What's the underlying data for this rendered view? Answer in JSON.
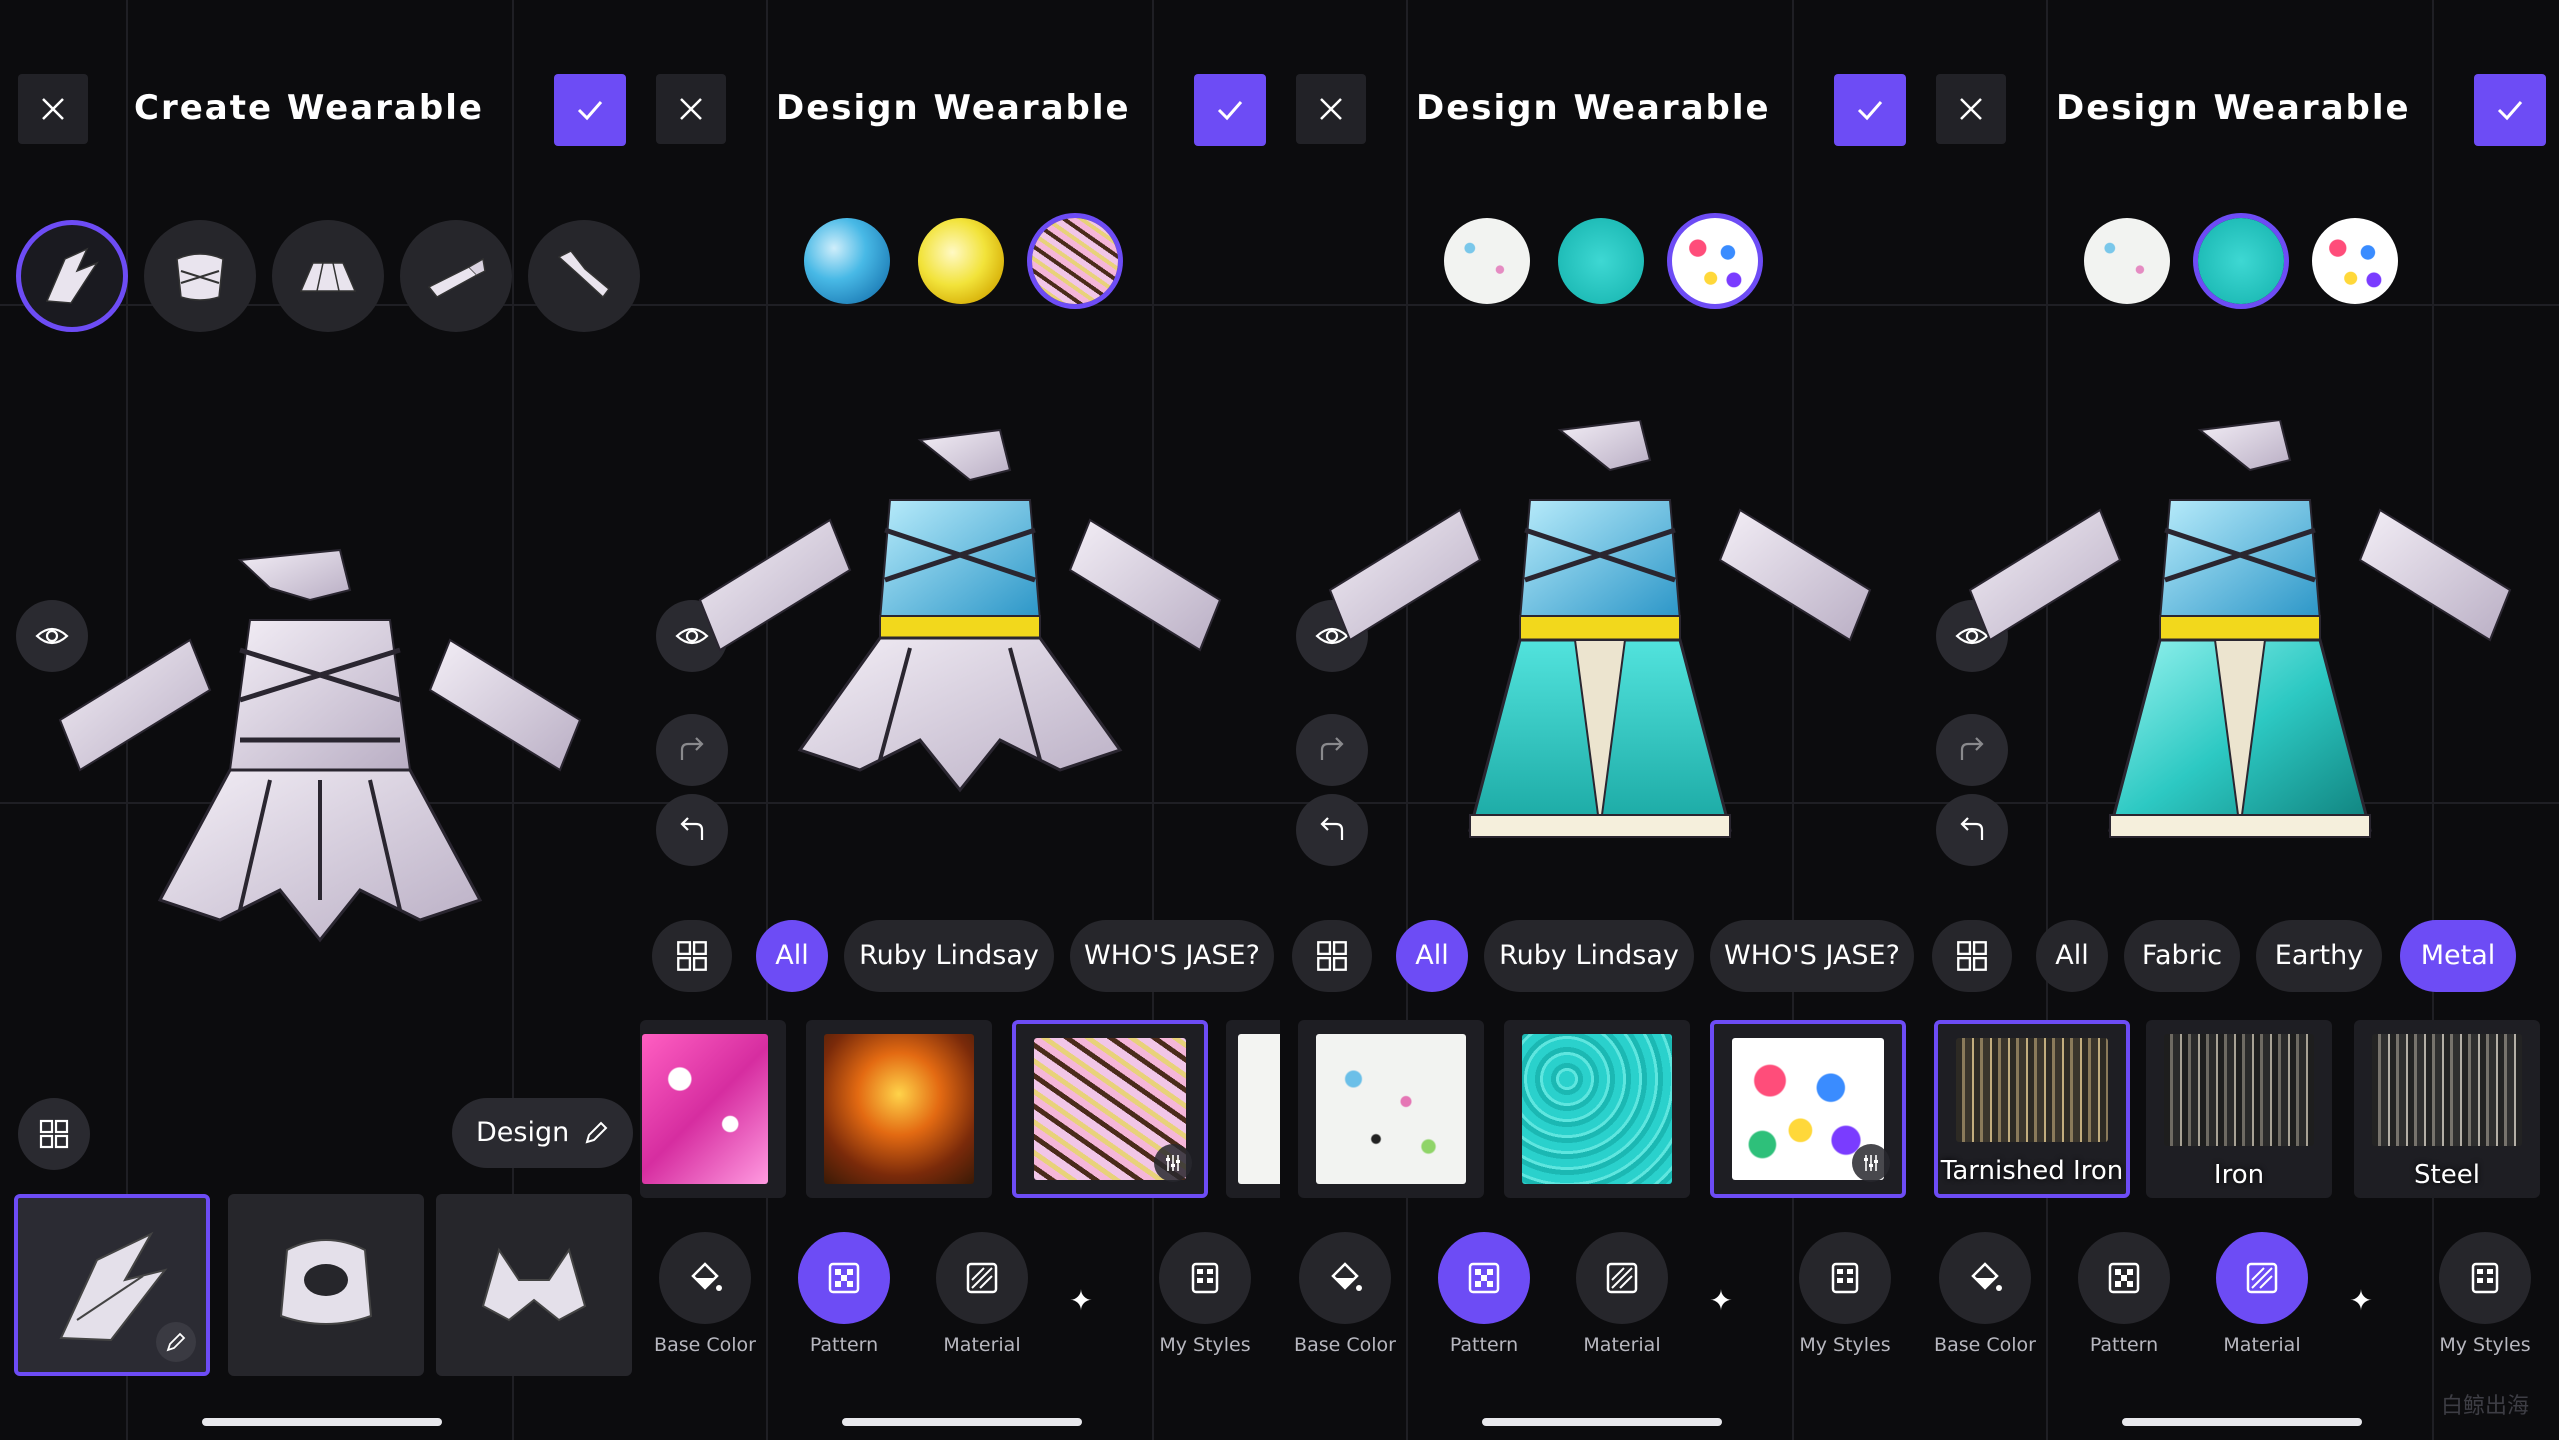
{
  "colors": {
    "accent": "#6d4cf5",
    "panel": "#0c0c0e",
    "chip": "#26262b"
  },
  "panels": [
    {
      "title": "Create Wearable",
      "close_icon": "close-icon",
      "confirm_icon": "check-icon",
      "pieces": [
        "full-dress",
        "bodice",
        "skirt",
        "sleeve",
        "bow"
      ],
      "selected_piece": 0,
      "design_button": "Design",
      "parts": [
        "dress-part",
        "bodice-part",
        "straps-part"
      ]
    },
    {
      "title": "Design Wearable",
      "swatches": [
        "blue-marble",
        "yellow-marble",
        "pink-tiger"
      ],
      "selected_swatch": 2,
      "chips": [
        "All",
        "Ruby Lindsay",
        "WHO'S JASE?"
      ],
      "selected_chip": 0,
      "modes": [
        "Base Color",
        "Pattern",
        "Material",
        "My Styles"
      ],
      "selected_mode": 1
    },
    {
      "title": "Design Wearable",
      "swatches": [
        "white-doodle",
        "teal-leopard",
        "flower-print"
      ],
      "selected_swatch": 2,
      "chips": [
        "All",
        "Ruby Lindsay",
        "WHO'S JASE?"
      ],
      "selected_chip": 0,
      "modes": [
        "Base Color",
        "Pattern",
        "Material",
        "My Styles"
      ],
      "selected_mode": 1
    },
    {
      "title": "Design Wearable",
      "swatches": [
        "white-doodle",
        "teal-leopard",
        "flower-print"
      ],
      "selected_swatch": 1,
      "chips": [
        "All",
        "Fabric",
        "Earthy",
        "Metal"
      ],
      "selected_chip": 3,
      "materials": [
        "Tarnished Iron",
        "Iron",
        "Steel"
      ],
      "selected_material": 0,
      "modes": [
        "Base Color",
        "Pattern",
        "Material",
        "My Styles"
      ],
      "selected_mode": 2
    }
  ],
  "watermark": "白鲸出海"
}
